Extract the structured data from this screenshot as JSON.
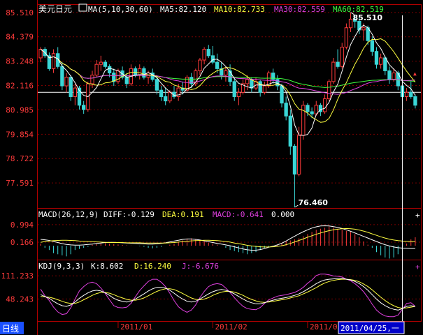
{
  "header": {
    "symbol": "美元日元",
    "ma_label": "MA(5,10,30,60)",
    "ma5": "MA5:82.120",
    "ma10": "MA10:82.733",
    "ma30": "MA30:82.559",
    "ma60": "MA60:82.519"
  },
  "macd_header": {
    "label": "MACD(26,12,9)",
    "diff": "DIFF:-0.129",
    "dea": "DEA:0.191",
    "macd": "MACD:-0.641",
    "extra": "0.000"
  },
  "kdj_header": {
    "label": "KDJ(9,3,3)",
    "k": "K:8.602",
    "d": "D:16.240",
    "j": "J:-6.676"
  },
  "footer": {
    "period_button": "日线",
    "cursor_date": "2011/04/25,一"
  },
  "controls": {
    "macd_plus": "+",
    "kdj_plus": "+",
    "main_marker": "▲"
  },
  "colors": {
    "background": "#000000",
    "frame": "#b00000",
    "up": "#ff3b3b",
    "down": "#3ad6d6",
    "ma5": "#ffffff",
    "ma10": "#ffff40",
    "ma30": "#e040e0",
    "ma60": "#40ff40",
    "tick_text": "#ff3b3b",
    "crosshair": "#ffffff",
    "period_button_bg": "#1a50ff",
    "date_box_bg": "#0000c8"
  },
  "chart_data": [
    {
      "type": "candlestick",
      "ylim": [
        76.46,
        85.7
      ],
      "y_ticks": [
        "85.510",
        "84.379",
        "83.248",
        "82.116",
        "80.985",
        "79.854",
        "78.722",
        "77.591"
      ],
      "x_ticks": [
        "2011/01",
        "2011/02",
        "2011/03"
      ],
      "annotations": [
        "85.510",
        "76.460"
      ],
      "reference_line": 81.8,
      "candles": [
        {
          "o": 83.4,
          "h": 83.9,
          "l": 83.2,
          "c": 83.8
        },
        {
          "o": 83.8,
          "h": 83.9,
          "l": 83.4,
          "c": 83.5
        },
        {
          "o": 83.5,
          "h": 83.65,
          "l": 82.8,
          "c": 82.9
        },
        {
          "o": 82.9,
          "h": 83.8,
          "l": 82.7,
          "c": 83.6
        },
        {
          "o": 83.6,
          "h": 83.9,
          "l": 82.9,
          "c": 83.0
        },
        {
          "o": 83.0,
          "h": 83.2,
          "l": 81.9,
          "c": 82.1
        },
        {
          "o": 82.1,
          "h": 82.7,
          "l": 81.8,
          "c": 82.5
        },
        {
          "o": 82.5,
          "h": 82.6,
          "l": 81.4,
          "c": 81.6
        },
        {
          "o": 81.6,
          "h": 82.2,
          "l": 81.2,
          "c": 82.0
        },
        {
          "o": 82.0,
          "h": 82.1,
          "l": 81.0,
          "c": 81.2
        },
        {
          "o": 81.2,
          "h": 81.4,
          "l": 80.8,
          "c": 81.0
        },
        {
          "o": 81.0,
          "h": 82.3,
          "l": 80.9,
          "c": 82.2
        },
        {
          "o": 82.2,
          "h": 82.8,
          "l": 82.0,
          "c": 82.6
        },
        {
          "o": 82.6,
          "h": 83.3,
          "l": 82.5,
          "c": 83.1
        },
        {
          "o": 83.1,
          "h": 83.5,
          "l": 82.8,
          "c": 83.2
        },
        {
          "o": 83.2,
          "h": 83.3,
          "l": 82.9,
          "c": 83.0
        },
        {
          "o": 83.0,
          "h": 83.1,
          "l": 82.5,
          "c": 82.7
        },
        {
          "o": 82.7,
          "h": 82.9,
          "l": 82.1,
          "c": 82.3
        },
        {
          "o": 82.3,
          "h": 82.9,
          "l": 82.2,
          "c": 82.8
        },
        {
          "o": 82.8,
          "h": 83.0,
          "l": 82.4,
          "c": 82.5
        },
        {
          "o": 82.5,
          "h": 82.7,
          "l": 82.0,
          "c": 82.2
        },
        {
          "o": 82.2,
          "h": 83.1,
          "l": 82.1,
          "c": 82.9
        },
        {
          "o": 82.9,
          "h": 83.0,
          "l": 82.5,
          "c": 82.6
        },
        {
          "o": 82.6,
          "h": 83.1,
          "l": 82.4,
          "c": 82.9
        },
        {
          "o": 82.9,
          "h": 83.0,
          "l": 82.4,
          "c": 82.5
        },
        {
          "o": 82.5,
          "h": 82.8,
          "l": 82.2,
          "c": 82.7
        },
        {
          "o": 82.7,
          "h": 82.9,
          "l": 82.3,
          "c": 82.4
        },
        {
          "o": 82.4,
          "h": 82.6,
          "l": 81.7,
          "c": 81.9
        },
        {
          "o": 81.9,
          "h": 82.1,
          "l": 81.4,
          "c": 81.6
        },
        {
          "o": 81.6,
          "h": 82.0,
          "l": 81.2,
          "c": 81.4
        },
        {
          "o": 81.4,
          "h": 81.9,
          "l": 81.3,
          "c": 81.8
        },
        {
          "o": 81.8,
          "h": 82.1,
          "l": 81.5,
          "c": 81.6
        },
        {
          "o": 81.6,
          "h": 82.2,
          "l": 81.4,
          "c": 82.0
        },
        {
          "o": 82.0,
          "h": 82.3,
          "l": 81.7,
          "c": 81.9
        },
        {
          "o": 81.9,
          "h": 82.6,
          "l": 81.8,
          "c": 82.5
        },
        {
          "o": 82.5,
          "h": 82.7,
          "l": 82.0,
          "c": 82.2
        },
        {
          "o": 82.2,
          "h": 82.9,
          "l": 82.1,
          "c": 82.8
        },
        {
          "o": 82.8,
          "h": 83.4,
          "l": 82.6,
          "c": 83.3
        },
        {
          "o": 83.3,
          "h": 83.9,
          "l": 83.1,
          "c": 83.8
        },
        {
          "o": 83.8,
          "h": 84.0,
          "l": 83.4,
          "c": 83.5
        },
        {
          "o": 83.5,
          "h": 83.95,
          "l": 83.1,
          "c": 83.2
        },
        {
          "o": 83.2,
          "h": 83.6,
          "l": 82.7,
          "c": 82.9
        },
        {
          "o": 82.9,
          "h": 83.2,
          "l": 82.4,
          "c": 82.6
        },
        {
          "o": 82.6,
          "h": 83.0,
          "l": 82.3,
          "c": 82.8
        },
        {
          "o": 82.8,
          "h": 83.1,
          "l": 82.1,
          "c": 82.3
        },
        {
          "o": 82.3,
          "h": 82.5,
          "l": 81.4,
          "c": 81.6
        },
        {
          "o": 81.6,
          "h": 82.0,
          "l": 81.2,
          "c": 81.8
        },
        {
          "o": 81.8,
          "h": 82.4,
          "l": 81.7,
          "c": 82.2
        },
        {
          "o": 82.2,
          "h": 82.6,
          "l": 81.9,
          "c": 82.4
        },
        {
          "o": 82.4,
          "h": 82.5,
          "l": 81.8,
          "c": 82.0
        },
        {
          "o": 82.0,
          "h": 82.5,
          "l": 81.9,
          "c": 82.3
        },
        {
          "o": 82.3,
          "h": 82.4,
          "l": 81.6,
          "c": 81.8
        },
        {
          "o": 81.8,
          "h": 82.3,
          "l": 81.7,
          "c": 82.1
        },
        {
          "o": 82.1,
          "h": 82.8,
          "l": 82.0,
          "c": 82.7
        },
        {
          "o": 82.7,
          "h": 82.9,
          "l": 82.2,
          "c": 82.4
        },
        {
          "o": 82.4,
          "h": 82.6,
          "l": 81.9,
          "c": 82.1
        },
        {
          "o": 82.1,
          "h": 82.2,
          "l": 81.1,
          "c": 81.3
        },
        {
          "o": 81.3,
          "h": 81.6,
          "l": 80.5,
          "c": 80.7
        },
        {
          "o": 80.7,
          "h": 81.0,
          "l": 78.9,
          "c": 79.3
        },
        {
          "o": 79.3,
          "h": 79.4,
          "l": 76.46,
          "c": 78.0
        },
        {
          "o": 78.0,
          "h": 80.2,
          "l": 77.9,
          "c": 79.8
        },
        {
          "o": 79.8,
          "h": 81.4,
          "l": 79.6,
          "c": 81.2
        },
        {
          "o": 81.2,
          "h": 81.3,
          "l": 80.7,
          "c": 80.9
        },
        {
          "o": 80.9,
          "h": 81.1,
          "l": 80.6,
          "c": 80.8
        },
        {
          "o": 80.8,
          "h": 81.4,
          "l": 80.7,
          "c": 81.2
        },
        {
          "o": 81.2,
          "h": 81.3,
          "l": 80.7,
          "c": 80.9
        },
        {
          "o": 80.9,
          "h": 81.7,
          "l": 80.8,
          "c": 81.5
        },
        {
          "o": 81.5,
          "h": 82.4,
          "l": 81.4,
          "c": 82.3
        },
        {
          "o": 82.3,
          "h": 83.4,
          "l": 82.2,
          "c": 83.2
        },
        {
          "o": 83.2,
          "h": 83.8,
          "l": 82.9,
          "c": 83.0
        },
        {
          "o": 83.0,
          "h": 84.1,
          "l": 82.9,
          "c": 83.9
        },
        {
          "o": 83.9,
          "h": 85.0,
          "l": 83.8,
          "c": 84.8
        },
        {
          "o": 84.8,
          "h": 85.51,
          "l": 84.6,
          "c": 85.2
        },
        {
          "o": 85.2,
          "h": 85.4,
          "l": 84.8,
          "c": 85.1
        },
        {
          "o": 85.1,
          "h": 85.3,
          "l": 84.5,
          "c": 84.7
        },
        {
          "o": 84.7,
          "h": 85.0,
          "l": 84.2,
          "c": 84.8
        },
        {
          "o": 84.8,
          "h": 84.9,
          "l": 84.0,
          "c": 84.2
        },
        {
          "o": 84.2,
          "h": 84.4,
          "l": 83.5,
          "c": 83.7
        },
        {
          "o": 83.7,
          "h": 83.9,
          "l": 82.9,
          "c": 83.1
        },
        {
          "o": 83.1,
          "h": 83.6,
          "l": 82.9,
          "c": 83.4
        },
        {
          "o": 83.4,
          "h": 83.5,
          "l": 82.6,
          "c": 82.8
        },
        {
          "o": 82.8,
          "h": 83.0,
          "l": 82.2,
          "c": 82.4
        },
        {
          "o": 82.4,
          "h": 82.9,
          "l": 82.3,
          "c": 82.7
        },
        {
          "o": 82.7,
          "h": 82.8,
          "l": 81.9,
          "c": 82.1
        },
        {
          "o": 82.1,
          "h": 82.3,
          "l": 81.4,
          "c": 81.6
        },
        {
          "o": 81.6,
          "h": 82.0,
          "l": 81.4,
          "c": 81.8
        },
        {
          "o": 81.8,
          "h": 82.3,
          "l": 81.5,
          "c": 81.6
        },
        {
          "o": 81.6,
          "h": 81.7,
          "l": 81.05,
          "c": 81.2
        }
      ]
    },
    {
      "type": "bar",
      "ylim": [
        -0.62,
        1.12
      ],
      "y_ticks": [
        "0.994",
        "0.166"
      ],
      "macd": [
        0.1,
        -0.1,
        -0.2,
        -0.35,
        -0.4,
        -0.45,
        -0.5,
        -0.4,
        -0.2,
        -0.15,
        -0.1,
        -0.05,
        0.05,
        0.08,
        0.1,
        0.12,
        0.1,
        0.08,
        0.06,
        0.04,
        0.02,
        0.01,
        0.0,
        -0.02,
        -0.05,
        -0.1,
        -0.12,
        -0.1,
        -0.05,
        0.0,
        0.05,
        0.1,
        0.2,
        0.25,
        0.3,
        0.35,
        0.3,
        0.25,
        0.2,
        0.15,
        0.1,
        0.05,
        0.0,
        -0.1,
        -0.2,
        -0.25,
        -0.3,
        -0.35,
        -0.4,
        -0.35,
        -0.3,
        -0.2,
        -0.1,
        -0.05,
        0.0,
        0.05,
        0.1,
        0.2,
        0.25,
        0.3,
        0.35,
        0.45,
        0.55,
        0.65,
        0.75,
        0.8,
        0.85,
        0.9,
        0.85,
        0.8,
        0.75,
        0.7,
        0.65,
        0.55,
        0.4,
        0.2,
        0.05,
        -0.1,
        -0.3,
        -0.45,
        -0.55,
        -0.6,
        -0.55,
        -0.4,
        -0.2,
        0.1,
        0.3,
        0.4
      ],
      "diff": [
        0.3,
        0.28,
        0.25,
        0.2,
        0.15,
        0.1,
        0.06,
        0.04,
        0.03,
        0.03,
        0.04,
        0.06,
        0.08,
        0.11,
        0.13,
        0.15,
        0.16,
        0.16,
        0.15,
        0.14,
        0.13,
        0.12,
        0.11,
        0.1,
        0.09,
        0.08,
        0.08,
        0.09,
        0.11,
        0.14,
        0.18,
        0.22,
        0.26,
        0.3,
        0.32,
        0.32,
        0.3,
        0.27,
        0.23,
        0.19,
        0.15,
        0.11,
        0.08,
        0.04,
        0.0,
        -0.05,
        -0.1,
        -0.15,
        -0.19,
        -0.21,
        -0.21,
        -0.18,
        -0.13,
        -0.07,
        -0.02,
        0.04,
        0.12,
        0.22,
        0.34,
        0.45,
        0.56,
        0.66,
        0.75,
        0.83,
        0.89,
        0.93,
        0.94,
        0.93,
        0.9,
        0.86,
        0.81,
        0.75,
        0.68,
        0.6,
        0.52,
        0.44,
        0.36,
        0.28,
        0.2,
        0.12,
        0.05,
        -0.01,
        -0.06,
        -0.09,
        -0.11,
        -0.12,
        -0.13,
        -0.129
      ],
      "dea": [
        0.16,
        0.2,
        0.22,
        0.24,
        0.25,
        0.26,
        0.26,
        0.25,
        0.24,
        0.22,
        0.21,
        0.2,
        0.19,
        0.18,
        0.17,
        0.16,
        0.15,
        0.15,
        0.15,
        0.15,
        0.14,
        0.14,
        0.14,
        0.14,
        0.13,
        0.13,
        0.13,
        0.13,
        0.13,
        0.13,
        0.14,
        0.15,
        0.17,
        0.19,
        0.21,
        0.23,
        0.24,
        0.25,
        0.26,
        0.26,
        0.25,
        0.24,
        0.22,
        0.2,
        0.17,
        0.13,
        0.1,
        0.06,
        0.02,
        -0.01,
        -0.03,
        -0.05,
        -0.06,
        -0.06,
        -0.05,
        -0.03,
        0.0,
        0.05,
        0.11,
        0.18,
        0.25,
        0.32,
        0.4,
        0.47,
        0.54,
        0.6,
        0.66,
        0.71,
        0.75,
        0.78,
        0.8,
        0.81,
        0.8,
        0.78,
        0.74,
        0.69,
        0.63,
        0.56,
        0.49,
        0.42,
        0.36,
        0.31,
        0.27,
        0.24,
        0.22,
        0.21,
        0.2,
        0.191
      ]
    },
    {
      "type": "line",
      "ylim": [
        -10,
        125
      ],
      "y_ticks": [
        "111.233",
        "48.243"
      ],
      "k": [
        60,
        55,
        50,
        42,
        35,
        30,
        28,
        32,
        40,
        50,
        58,
        65,
        70,
        72,
        70,
        65,
        58,
        50,
        45,
        42,
        40,
        42,
        48,
        55,
        62,
        70,
        76,
        80,
        80,
        78,
        72,
        64,
        55,
        48,
        42,
        40,
        42,
        48,
        55,
        62,
        68,
        72,
        74,
        72,
        68,
        62,
        55,
        48,
        42,
        38,
        35,
        35,
        38,
        42,
        45,
        48,
        50,
        52,
        55,
        58,
        62,
        68,
        75,
        82,
        90,
        96,
        100,
        102,
        103,
        104,
        104,
        102,
        100,
        96,
        90,
        82,
        72,
        60,
        48,
        38,
        30,
        24,
        20,
        18,
        22,
        28,
        30,
        28
      ],
      "d": [
        55,
        54,
        53,
        50,
        46,
        42,
        38,
        36,
        36,
        40,
        46,
        52,
        58,
        63,
        66,
        66,
        64,
        60,
        55,
        51,
        47,
        45,
        45,
        47,
        51,
        57,
        63,
        69,
        73,
        76,
        76,
        74,
        69,
        63,
        57,
        51,
        47,
        46,
        48,
        52,
        58,
        63,
        67,
        69,
        69,
        67,
        63,
        58,
        52,
        47,
        43,
        40,
        39,
        40,
        42,
        44,
        46,
        48,
        51,
        54,
        57,
        62,
        67,
        73,
        79,
        86,
        92,
        96,
        99,
        101,
        102,
        102,
        101,
        99,
        95,
        89,
        82,
        73,
        63,
        53,
        44,
        36,
        30,
        25,
        23,
        24,
        26,
        28
      ],
      "j": [
        75,
        57,
        44,
        26,
        13,
        6,
        8,
        24,
        48,
        70,
        82,
        91,
        94,
        90,
        78,
        63,
        46,
        30,
        25,
        24,
        26,
        36,
        54,
        71,
        84,
        96,
        102,
        102,
        94,
        82,
        64,
        44,
        27,
        18,
        12,
        18,
        32,
        52,
        69,
        82,
        88,
        90,
        88,
        78,
        66,
        52,
        39,
        28,
        22,
        20,
        19,
        25,
        36,
        46,
        51,
        56,
        58,
        60,
        63,
        66,
        72,
        80,
        91,
        100,
        112,
        116,
        116,
        114,
        111,
        110,
        108,
        102,
        98,
        90,
        80,
        68,
        52,
        34,
        18,
        8,
        2,
        0,
        0,
        4,
        20,
        36,
        38,
        28
      ]
    }
  ]
}
